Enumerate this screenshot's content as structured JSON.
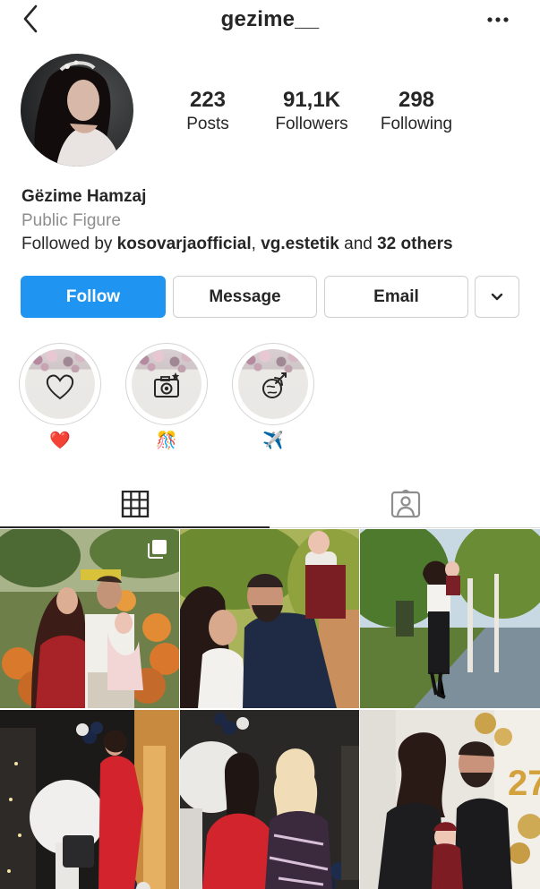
{
  "header": {
    "username": "gezime__",
    "back_icon": "chevron-left-icon",
    "more_icon": "more-horizontal-icon"
  },
  "profile": {
    "stats": [
      {
        "value": "223",
        "label": "Posts"
      },
      {
        "value": "91,1K",
        "label": "Followers"
      },
      {
        "value": "298",
        "label": "Following"
      }
    ],
    "name": "Gëzime Hamzaj",
    "category": "Public Figure",
    "followed_by": {
      "prefix": "Followed by ",
      "user1": "kosovarjaofficial",
      "sep": ", ",
      "user2": "vg.estetik",
      "and": " and ",
      "others": "32 others"
    }
  },
  "actions": {
    "follow": "Follow",
    "message": "Message",
    "email": "Email",
    "dropdown_icon": "chevron-down-icon"
  },
  "highlights": [
    {
      "label": "❤️",
      "icon": "heart-icon"
    },
    {
      "label": "🎊",
      "icon": "camera-icon"
    },
    {
      "label": "✈️",
      "icon": "airplane-globe-icon"
    }
  ],
  "tabs": [
    {
      "name": "grid",
      "icon": "grid-icon",
      "active": true
    },
    {
      "name": "tagged",
      "icon": "tagged-user-icon",
      "active": false
    }
  ],
  "posts": [
    {
      "id": 1,
      "multi": true,
      "icon": "multiple-images-icon"
    },
    {
      "id": 2,
      "multi": false
    },
    {
      "id": 3,
      "multi": false
    },
    {
      "id": 4,
      "multi": false
    },
    {
      "id": 5,
      "multi": false
    },
    {
      "id": 6,
      "multi": false
    }
  ],
  "colors": {
    "accent": "#1f95f1",
    "text": "#262626",
    "muted": "#8e8e8e",
    "border": "#dbdbdb"
  }
}
